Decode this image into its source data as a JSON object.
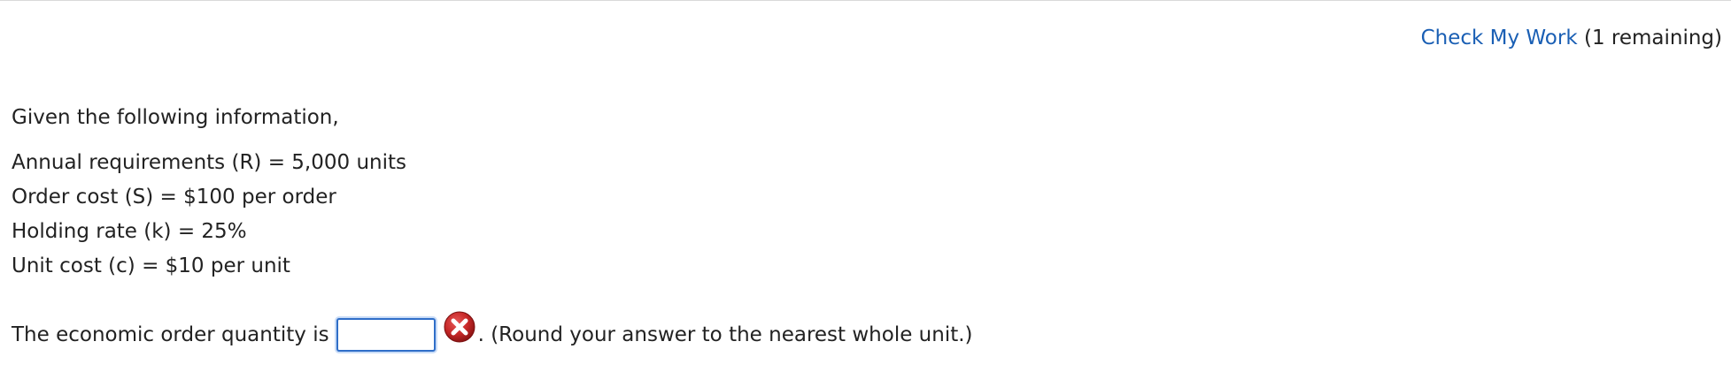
{
  "header": {
    "check_link_label": "Check My Work",
    "remaining_text": "(1 remaining)"
  },
  "problem": {
    "intro": "Given the following information,",
    "given": [
      "Annual requirements (R) = 5,000 units",
      "Order cost (S) = $100 per order",
      "Holding rate (k) = 25%",
      "Unit cost (c) = $10 per unit"
    ]
  },
  "question": {
    "prefix": "The economic order quantity is",
    "answer_value": "",
    "suffix": ". (Round your answer to the nearest whole unit.)",
    "status_icon": "incorrect-x-icon"
  },
  "colors": {
    "link": "#1a5fb4",
    "input_border": "#2f6ec8",
    "error_icon": "#c62828"
  }
}
